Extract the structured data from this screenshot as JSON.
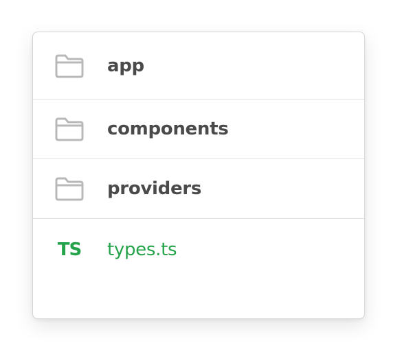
{
  "tree": {
    "items": [
      {
        "label": "app",
        "icon": "folder-icon",
        "type": "folder"
      },
      {
        "label": "components",
        "icon": "folder-icon",
        "type": "folder"
      },
      {
        "label": "providers",
        "icon": "folder-icon",
        "type": "folder"
      },
      {
        "label": "types.ts",
        "icon": "typescript-file-icon",
        "icon_text": "TS",
        "type": "file"
      }
    ]
  },
  "colors": {
    "folder_stroke": "#b8b8b8",
    "folder_label": "#4a4a4a",
    "typescript_green": "#24a34a",
    "divider": "#e1e1e1"
  }
}
